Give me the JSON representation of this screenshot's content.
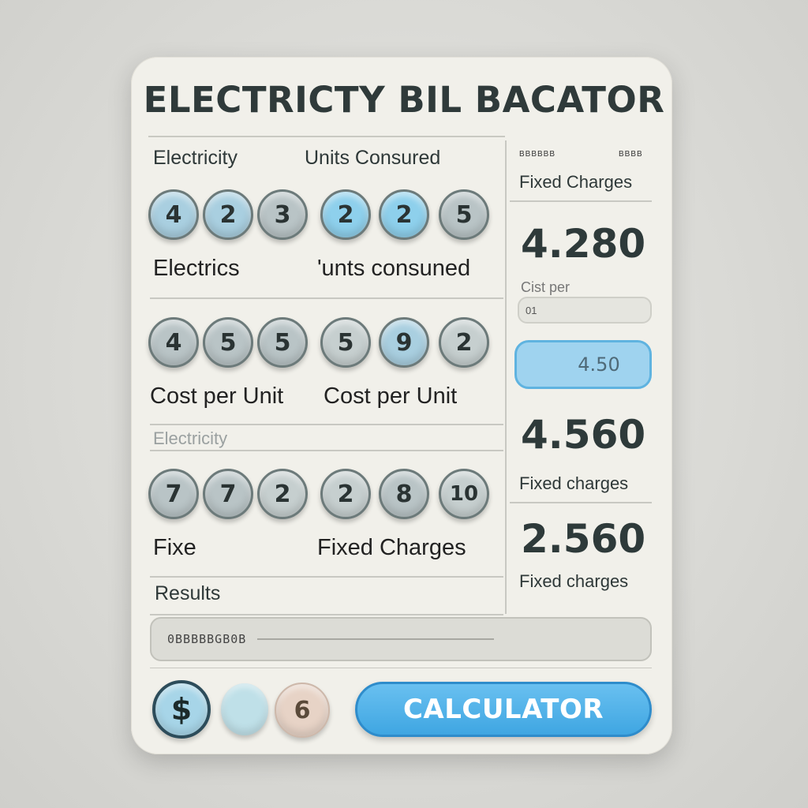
{
  "app": {
    "title": "ELECTRICTY BIL BACATOR"
  },
  "left_panel": {
    "section1": {
      "label_left": "Electricity",
      "label_right": "Units Consured",
      "digits": [
        "4",
        "2",
        "3",
        "2",
        "2",
        "5"
      ],
      "caption_left": "Electrics",
      "caption_right": "'unts consuned"
    },
    "section2": {
      "digits": [
        "4",
        "5",
        "5",
        "5",
        "9",
        "2"
      ],
      "caption_left": "Cost per Unit",
      "caption_right": "Cost per Unit",
      "faint_label": "Electricity"
    },
    "section3": {
      "digits": [
        "7",
        "7",
        "2",
        "2",
        "8",
        "10"
      ],
      "caption_left": "Fixe",
      "caption_right": "Fixed Charges"
    },
    "results": {
      "label": "Results",
      "value": "0BBBBBGB0B"
    }
  },
  "right_panel": {
    "small_header_left": "BBBBBB",
    "small_header_right": "BBBB",
    "fixed_charges_1": "Fixed Charges",
    "value_1": "4.280",
    "cost_per_label": "Cist per",
    "cost_per_input": "01",
    "input_value": "4.50",
    "value_2": "4.560",
    "fixed_charges_2": "Fixed charges",
    "value_3": "2.560",
    "fixed_charges_3": "Fixed charges"
  },
  "bottom_bar": {
    "dollar_label": "$",
    "number_label": "6",
    "calculate_label": "CALCULATOR"
  },
  "colors": {
    "accent_blue": "#4aaee6",
    "card_bg": "#f1f0ea",
    "page_bg": "#d9d9d5"
  }
}
